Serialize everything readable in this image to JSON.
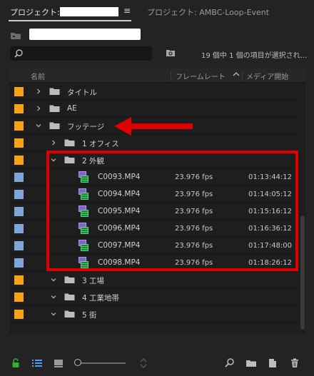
{
  "tabs": {
    "active_label": "プロジェクト:",
    "other_label": "プロジェクト: AMBC-Loop-Event",
    "menu_icon": "hamburger-icon"
  },
  "search": {
    "placeholder": "",
    "status": "19 個中 1 個の項目が選択され..."
  },
  "columns": {
    "name": "名前",
    "frame_rate": "フレームレート",
    "media_start": "メディア開始"
  },
  "colors": {
    "label_orange": "#f7a21b",
    "label_blue": "#7ea6d8",
    "annotation_red": "#e00000",
    "lock_green": "#2fb22f",
    "list_icon_blue": "#4f9ef5"
  },
  "rows": [
    {
      "type": "folder",
      "name": "タイトル",
      "expanded": false,
      "level": 0,
      "label": "orange"
    },
    {
      "type": "folder",
      "name": "AE",
      "expanded": false,
      "level": 0,
      "label": "orange"
    },
    {
      "type": "folder",
      "name": "フッテージ",
      "expanded": true,
      "level": 0,
      "label": "orange"
    },
    {
      "type": "folder",
      "name": "1 オフィス",
      "expanded": false,
      "level": 1,
      "label": "orange"
    },
    {
      "type": "folder",
      "name": "2 外観",
      "expanded": true,
      "level": 1,
      "label": "orange"
    },
    {
      "type": "clip",
      "name": "C0093.MP4",
      "fps": "23.976 fps",
      "start": "01:13:44:12",
      "level": 2,
      "label": "blue"
    },
    {
      "type": "clip",
      "name": "C0094.MP4",
      "fps": "23.976 fps",
      "start": "01:14:05:12",
      "level": 2,
      "label": "blue"
    },
    {
      "type": "clip",
      "name": "C0095.MP4",
      "fps": "23.976 fps",
      "start": "01:15:16:12",
      "level": 2,
      "label": "blue"
    },
    {
      "type": "clip",
      "name": "C0096.MP4",
      "fps": "23.976 fps",
      "start": "01:16:36:12",
      "level": 2,
      "label": "blue"
    },
    {
      "type": "clip",
      "name": "C0097.MP4",
      "fps": "23.976 fps",
      "start": "01:17:48:00",
      "level": 2,
      "label": "blue"
    },
    {
      "type": "clip",
      "name": "C0098.MP4",
      "fps": "23.976 fps",
      "start": "01:18:26:12",
      "level": 2,
      "label": "blue"
    },
    {
      "type": "folder",
      "name": "3 工場",
      "expanded": true,
      "level": 1,
      "label": "orange"
    },
    {
      "type": "folder",
      "name": "4 工業地帯",
      "expanded": true,
      "level": 1,
      "label": "orange"
    },
    {
      "type": "folder",
      "name": "5 街",
      "expanded": true,
      "level": 1,
      "label": "orange"
    }
  ],
  "toolbar": {
    "icons": [
      "lock-icon",
      "list-view-icon",
      "icon-view-icon",
      "zoom-slider",
      "sort-icons-icon",
      "find-icon",
      "new-bin-icon",
      "new-item-icon",
      "clear-icon"
    ]
  }
}
